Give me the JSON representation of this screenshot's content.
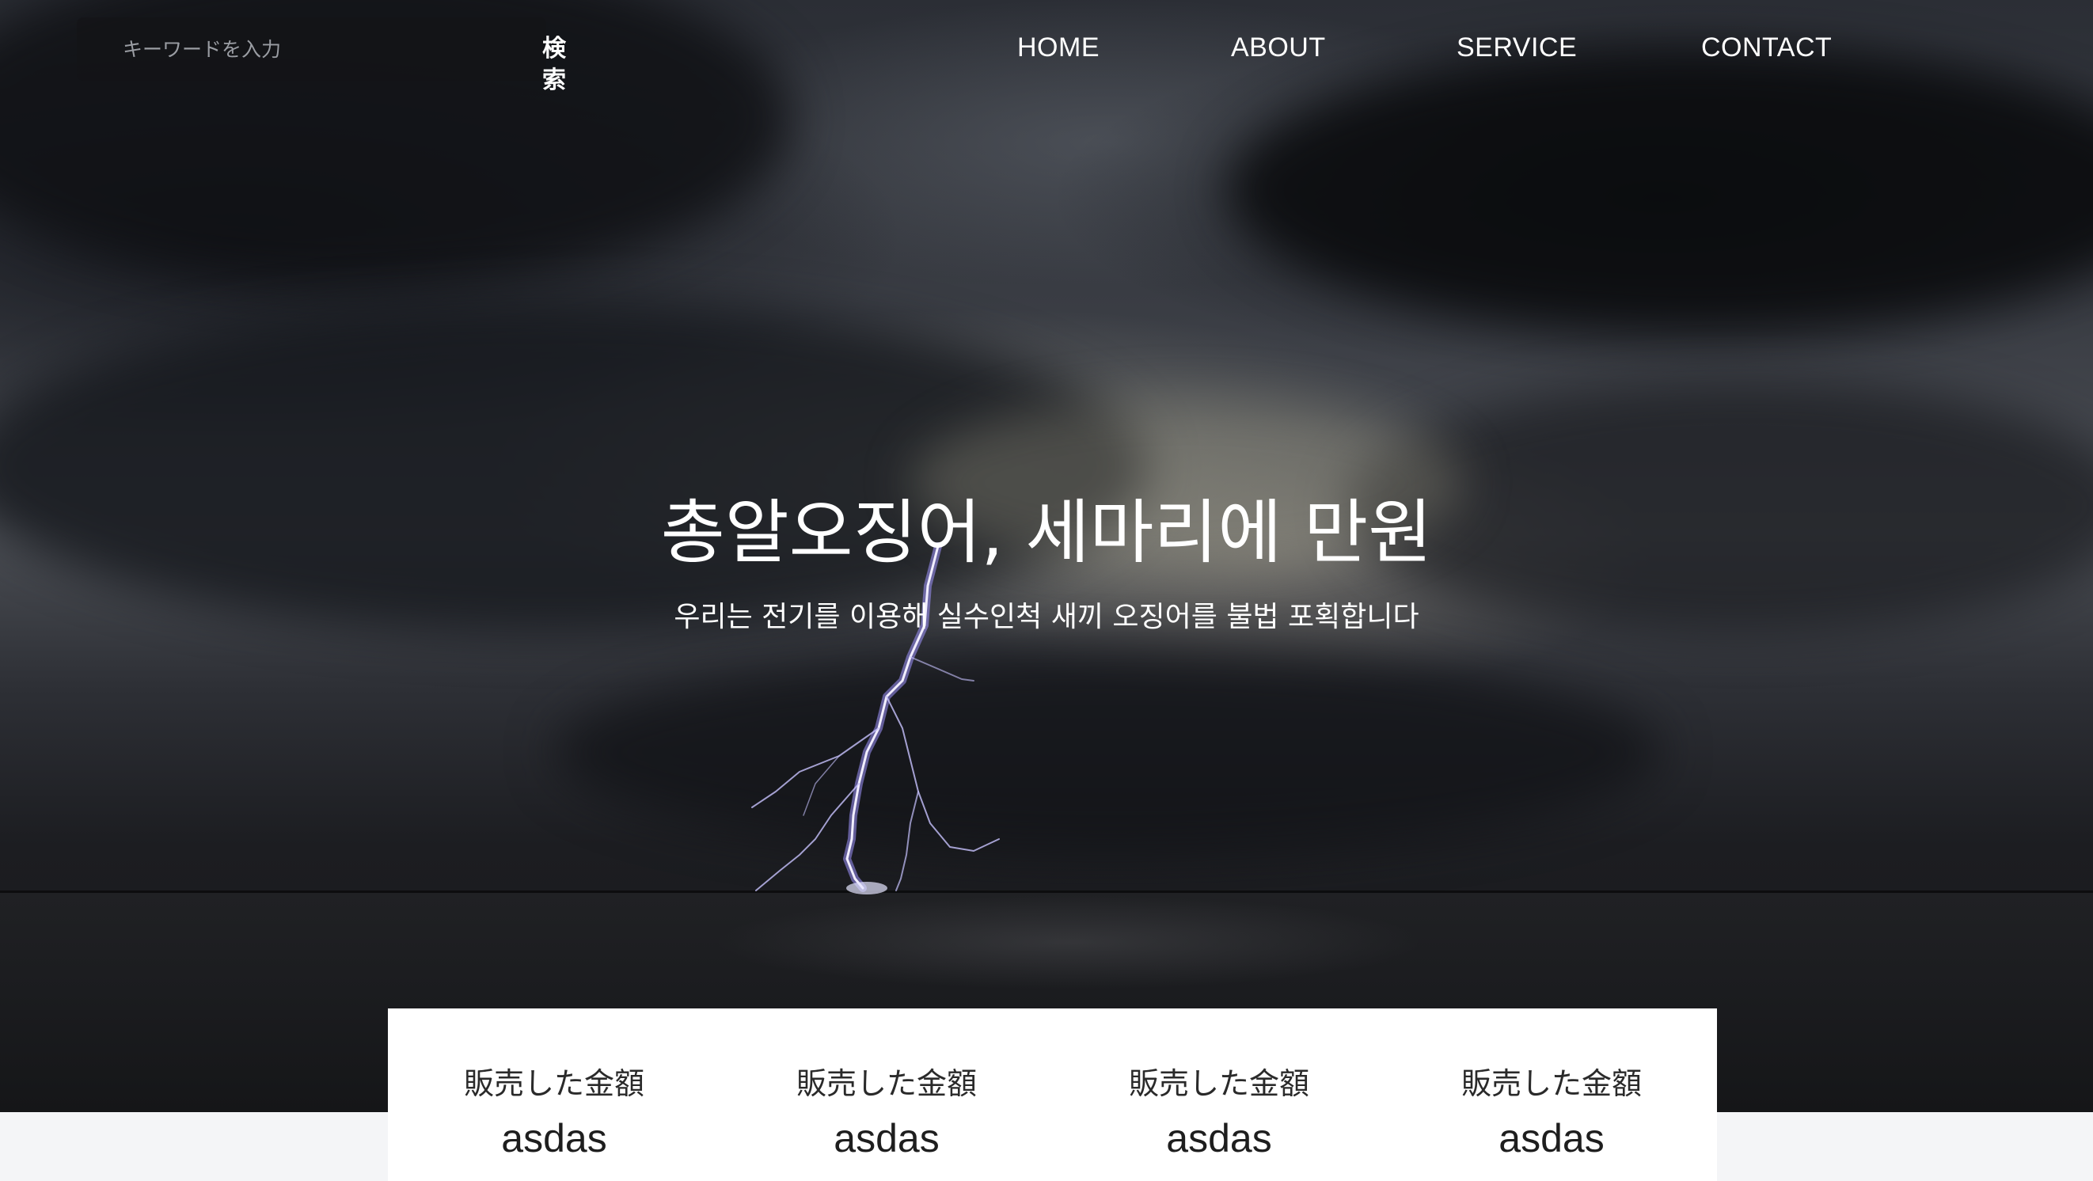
{
  "search": {
    "placeholder": "キーワードを入力",
    "button_label": "検索"
  },
  "nav": {
    "items": [
      {
        "label": "HOME"
      },
      {
        "label": "ABOUT"
      },
      {
        "label": "SERVICE"
      },
      {
        "label": "CONTACT"
      }
    ]
  },
  "hero": {
    "title": "총알오징어, 세마리에 만원",
    "subtitle": "우리는 전기를 이용해 실수인척 새끼 오징어를 불법 포획합니다"
  },
  "stats": [
    {
      "label": "販売した金額",
      "value": "asdas"
    },
    {
      "label": "販売した金額",
      "value": "asdas"
    },
    {
      "label": "販売した金額",
      "value": "asdas"
    },
    {
      "label": "販売した金額",
      "value": "asdas"
    }
  ],
  "colors": {
    "nav_text": "#ffffff",
    "card_background": "#ffffff",
    "page_background": "#f4f5f7"
  }
}
